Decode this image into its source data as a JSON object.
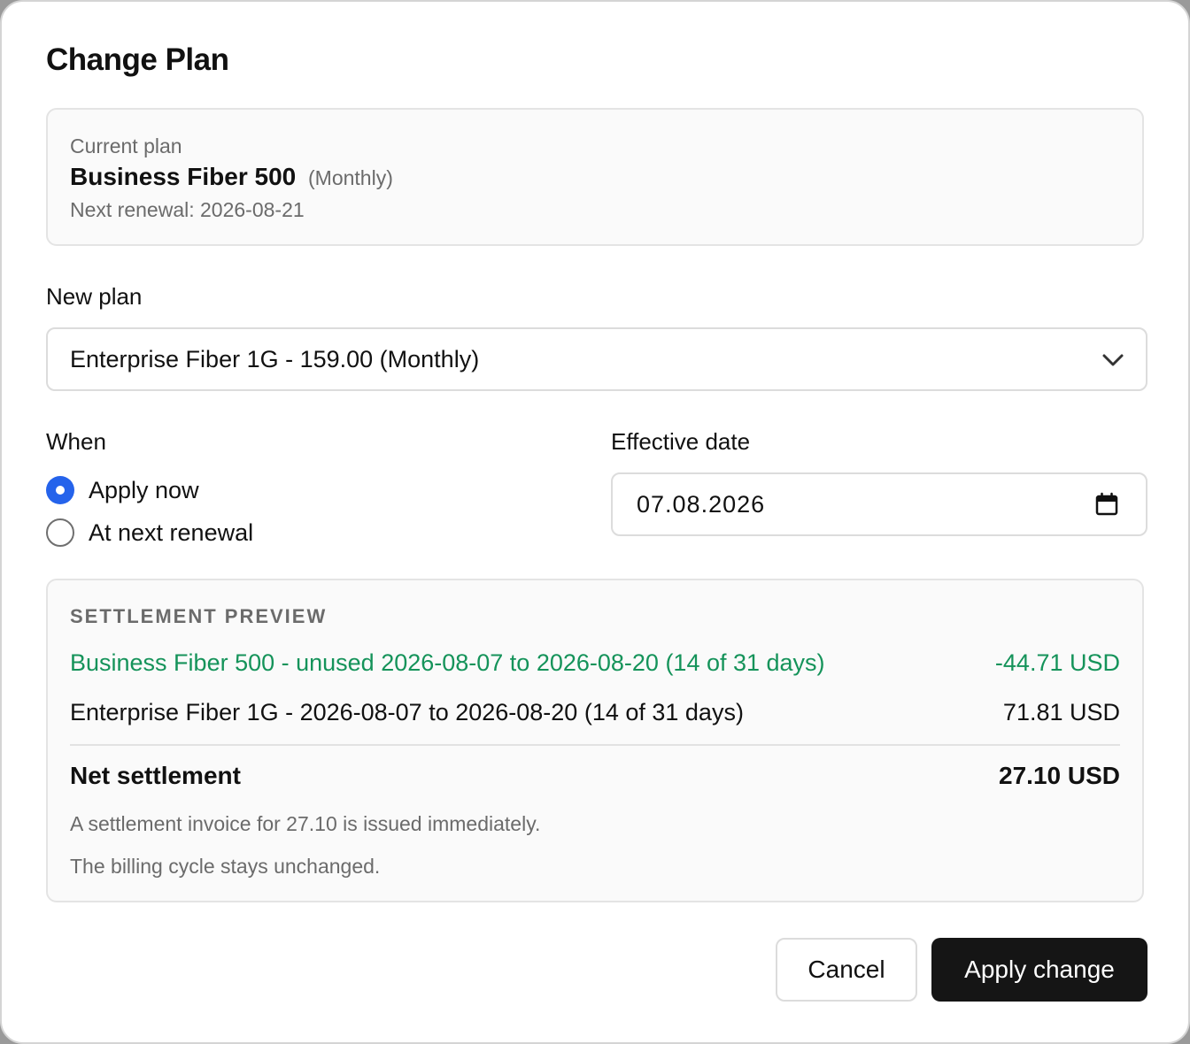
{
  "dialog": {
    "title": "Change Plan"
  },
  "current_plan": {
    "label": "Current plan",
    "name": "Business Fiber 500",
    "cycle": "(Monthly)",
    "renewal": "Next renewal: 2026-08-21"
  },
  "new_plan": {
    "label": "New plan",
    "selected": "Enterprise Fiber 1G - 159.00 (Monthly)"
  },
  "when": {
    "label": "When",
    "options": [
      {
        "label": "Apply now",
        "checked": true
      },
      {
        "label": "At next renewal",
        "checked": false
      }
    ]
  },
  "effective_date": {
    "label": "Effective date",
    "value": "07.08.2026"
  },
  "settlement": {
    "heading": "SETTLEMENT PREVIEW",
    "lines": [
      {
        "description": "Business Fiber 500 - unused 2026-08-07 to 2026-08-20 (14 of 31 days)",
        "amount": "-44.71 USD"
      },
      {
        "description": "Enterprise Fiber 1G - 2026-08-07 to 2026-08-20 (14 of 31 days)",
        "amount": "71.81 USD"
      }
    ],
    "net_label": "Net settlement",
    "net_amount": "27.10 USD",
    "notes": [
      "A settlement invoice for 27.10 is issued immediately.",
      "The billing cycle stays unchanged."
    ]
  },
  "actions": {
    "cancel_label": "Cancel",
    "apply_label": "Apply change"
  },
  "colors": {
    "accent": "#2563eb",
    "credit": "#15935a",
    "primary_button": "#151515"
  },
  "icons": {
    "dropdown": "chevron-down-icon",
    "date": "calendar-icon"
  }
}
